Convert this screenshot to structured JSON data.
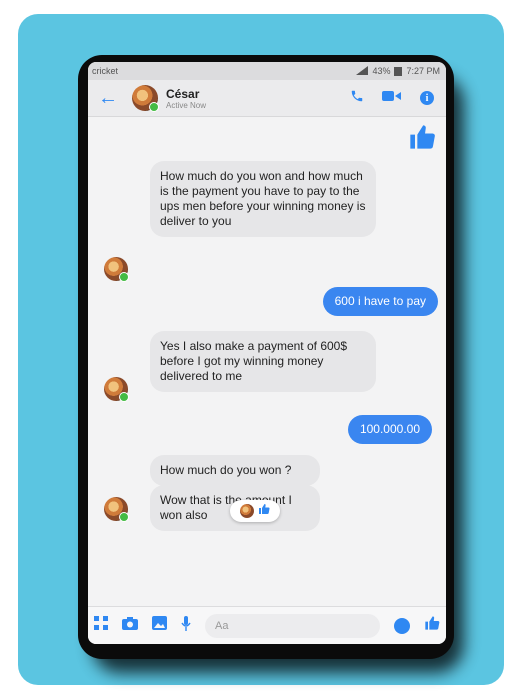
{
  "status": {
    "carrier": "cricket",
    "right_text": "43%",
    "time": "7:27 PM"
  },
  "header": {
    "contact_name": "César",
    "contact_status": "Active Now"
  },
  "messages": [
    {
      "side": "in",
      "text": "How much do you won and how much is the payment you have to pay to the ups men before your winning money is deliver to you"
    },
    {
      "side": "out",
      "text": "600 i have to pay"
    },
    {
      "side": "in",
      "text": "Yes I also make a payment of 600$ before I got my winning money delivered to me"
    },
    {
      "side": "out",
      "text": "100.000.00"
    },
    {
      "side": "in",
      "text": "How much do you won ?"
    },
    {
      "side": "in",
      "text": "Wow that is the amount I won also"
    }
  ],
  "composer": {
    "placeholder": "Aa"
  },
  "icons": {
    "back": "arrow-left-icon",
    "call": "phone-icon",
    "video": "video-camera-icon",
    "info": "info-icon",
    "like": "thumbs-up-icon",
    "apps": "grid-icon",
    "camera": "camera-icon",
    "gallery": "image-icon",
    "mic": "microphone-icon",
    "emoji": "emoji-icon"
  },
  "colors": {
    "accent": "#3a86f0",
    "card": "#5bc5e1",
    "incoming_bubble": "#e6e6e8"
  }
}
